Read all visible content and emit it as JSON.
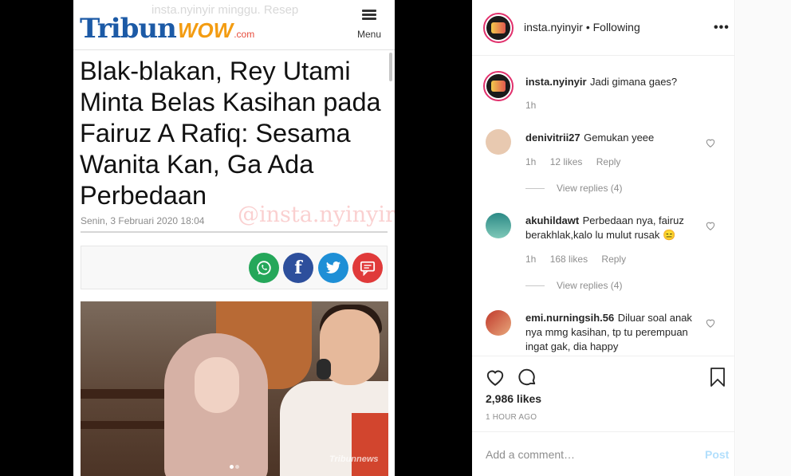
{
  "article": {
    "ghost_text": "insta.nyinyir   minggu. Resep",
    "logo_tribun": "Tribun",
    "logo_wow": "WOW",
    "logo_com": ".com",
    "menu_label": "Menu",
    "headline": "Blak-blakan, Rey Utami Minta Belas Kasihan pada Fairuz A Rafiq: Sesama Wanita Kan, Ga Ada Perbedaan",
    "date": "Senin, 3 Februari 2020 18:04",
    "watermark": "@insta.nyinyir",
    "photo_watermark": "Tribunnews",
    "share_icons": [
      "whatsapp-icon",
      "facebook-icon",
      "twitter-icon",
      "message-icon"
    ]
  },
  "post": {
    "username": "insta.nyinyir",
    "separator": "•",
    "follow_status": "Following",
    "more": "•••",
    "caption_user": "insta.nyinyir",
    "caption_text": "Jadi gimana gaes?",
    "caption_time": "1h",
    "comments": [
      {
        "user": "denivitrii27",
        "text": "Gemukan yeee",
        "time": "1h",
        "likes": "12 likes",
        "reply": "Reply",
        "view_replies": "View replies (4)"
      },
      {
        "user": "akuhildawt",
        "text": "Perbedaan nya, fairuz berakhlak,kalo lu mulut rusak 😑",
        "time": "1h",
        "likes": "168 likes",
        "reply": "Reply",
        "view_replies": "View replies (4)"
      },
      {
        "user": "emi.nurningsih.56",
        "text": "Diluar soal anak nya mmg kasihan, tp tu perempuan ingat gak, dia happy"
      }
    ],
    "like_count": "2,986 likes",
    "time_ago": "1 HOUR AGO",
    "comment_placeholder": "Add a comment…",
    "post_label": "Post"
  }
}
